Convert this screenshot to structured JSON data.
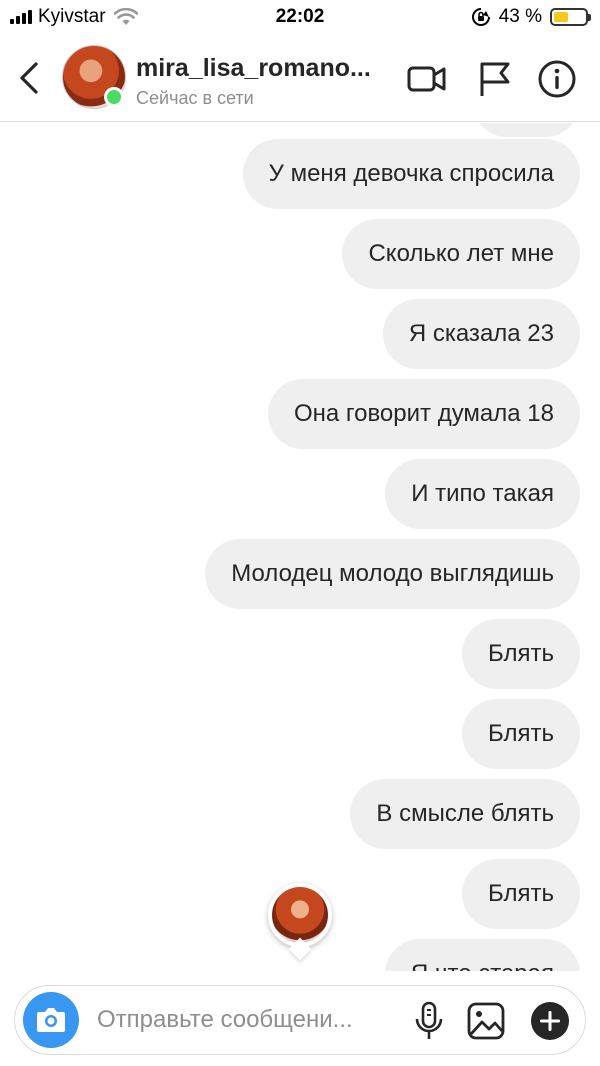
{
  "status_bar": {
    "carrier": "Kyivstar",
    "time": "22:02",
    "battery_text": "43 %",
    "battery_color": "#f7c81b"
  },
  "header": {
    "username": "mira_lisa_romano...",
    "presence": "Сейчас в сети",
    "online_color": "#4cd964",
    "icons": [
      "back-icon",
      "video-camera-icon",
      "flag-icon",
      "info-icon"
    ]
  },
  "messages": [
    {
      "text": "У меня девочка спросила"
    },
    {
      "text": "Сколько лет мне"
    },
    {
      "text": "Я сказала 23"
    },
    {
      "text": "Она говорит думала 18"
    },
    {
      "text": "И типо такая"
    },
    {
      "text": "Молодец молодо выглядишь"
    },
    {
      "text": "Блять"
    },
    {
      "text": "Блять"
    },
    {
      "text": "В смысле блять"
    },
    {
      "text": "Блять"
    },
    {
      "text": "Я что старая"
    }
  ],
  "composer": {
    "placeholder": "Отправьте сообщени...",
    "camera_color": "#3897f0",
    "icons": [
      "camera-icon",
      "microphone-icon",
      "gallery-icon",
      "plus-icon"
    ]
  }
}
